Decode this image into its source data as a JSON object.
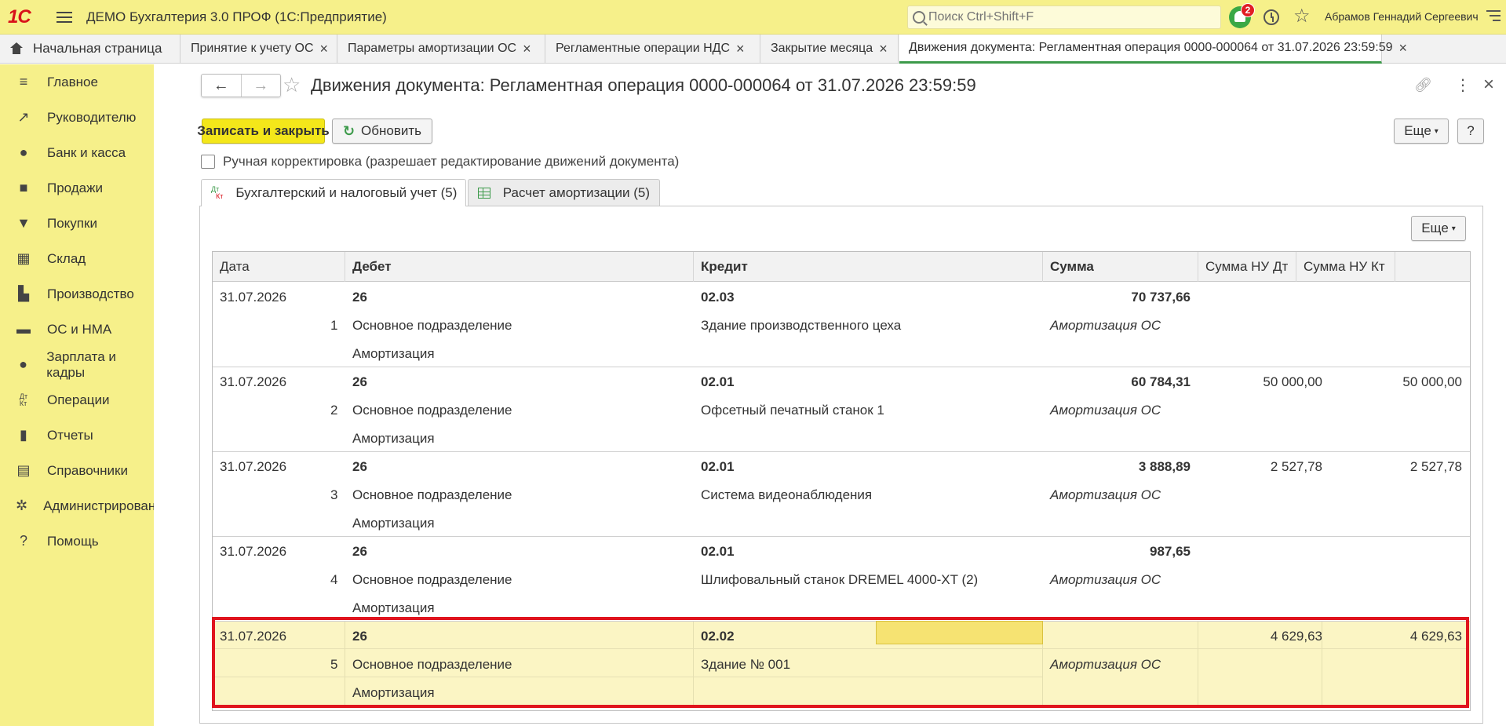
{
  "topbar": {
    "logo": "1С",
    "app_title": "ДЕМО Бухгалтерия 3.0 ПРОФ  (1С:Предприятие)",
    "search_placeholder": "Поиск Ctrl+Shift+F",
    "notifications_count": "2",
    "user_name": "Абрамов Геннадий Сергеевич"
  },
  "tabs": [
    {
      "label": "Начальная страница"
    },
    {
      "label": "Принятие к учету ОС"
    },
    {
      "label": "Параметры амортизации ОС"
    },
    {
      "label": "Регламентные операции НДС"
    },
    {
      "label": "Закрытие месяца"
    },
    {
      "label": "Движения документа: Регламентная операция 0000-000064 от 31.07.2026 23:59:59"
    }
  ],
  "sidebar": {
    "items": [
      {
        "label": "Главное",
        "icon": "menu-icon"
      },
      {
        "label": "Руководителю",
        "icon": "trend-icon"
      },
      {
        "label": "Банк и касса",
        "icon": "ruble-coin-icon"
      },
      {
        "label": "Продажи",
        "icon": "bag-icon"
      },
      {
        "label": "Покупки",
        "icon": "cart-icon"
      },
      {
        "label": "Склад",
        "icon": "warehouse-icon"
      },
      {
        "label": "Производство",
        "icon": "factory-icon"
      },
      {
        "label": "ОС и НМА",
        "icon": "truck-icon"
      },
      {
        "label": "Зарплата и кадры",
        "icon": "person-icon"
      },
      {
        "label": "Операции",
        "icon": "dt-kt-icon"
      },
      {
        "label": "Отчеты",
        "icon": "bar-chart-icon"
      },
      {
        "label": "Справочники",
        "icon": "books-icon"
      },
      {
        "label": "Администрирование",
        "icon": "gear-icon"
      },
      {
        "label": "Помощь",
        "icon": "question-icon"
      }
    ]
  },
  "document": {
    "title": "Движения документа: Регламентная операция 0000-000064 от 31.07.2026 23:59:59",
    "save_close_label": "Записать и закрыть",
    "refresh_label": "Обновить",
    "more_label": "Еще",
    "help_label": "?",
    "manual_correction_label": "Ручная корректировка (разрешает редактирование движений документа)",
    "form_tabs": [
      {
        "label": "Бухгалтерский и налоговый учет (5)"
      },
      {
        "label": "Расчет амортизации (5)"
      }
    ],
    "table_more_label": "Еще"
  },
  "table": {
    "columns": [
      "Дата",
      "Дебет",
      "Кредит",
      "Сумма",
      "Сумма НУ Дт",
      "Сумма НУ Кт"
    ],
    "rows": [
      {
        "date": "31.07.2026",
        "num": "1",
        "debit_account": "26",
        "debit_sub1": "Основное подразделение",
        "debit_sub2": "Амортизация",
        "credit_account": "02.03",
        "credit_sub1": "Здание производственного цеха",
        "sum": "70 737,66",
        "content": "Амортизация ОС",
        "nu_dt": "",
        "nu_kt": ""
      },
      {
        "date": "31.07.2026",
        "num": "2",
        "debit_account": "26",
        "debit_sub1": "Основное подразделение",
        "debit_sub2": "Амортизация",
        "credit_account": "02.01",
        "credit_sub1": "Офсетный печатный станок 1",
        "sum": "60 784,31",
        "content": "Амортизация ОС",
        "nu_dt": "50 000,00",
        "nu_kt": "50 000,00"
      },
      {
        "date": "31.07.2026",
        "num": "3",
        "debit_account": "26",
        "debit_sub1": "Основное подразделение",
        "debit_sub2": "Амортизация",
        "credit_account": "02.01",
        "credit_sub1": "Система видеонаблюдения",
        "sum": "3 888,89",
        "content": "Амортизация ОС",
        "nu_dt": "2 527,78",
        "nu_kt": "2 527,78"
      },
      {
        "date": "31.07.2026",
        "num": "4",
        "debit_account": "26",
        "debit_sub1": "Основное подразделение",
        "debit_sub2": "Амортизация",
        "credit_account": "02.01",
        "credit_sub1": "Шлифовальный станок DREMEL 4000-XT (2)",
        "sum": "987,65",
        "content": "Амортизация ОС",
        "nu_dt": "",
        "nu_kt": ""
      },
      {
        "date": "31.07.2026",
        "num": "5",
        "debit_account": "26",
        "debit_sub1": "Основное подразделение",
        "debit_sub2": "Амортизация",
        "credit_account": "02.02",
        "credit_sub1": "Здание № 001",
        "sum": "",
        "content": "Амортизация ОС",
        "nu_dt": "4 629,63",
        "nu_kt": "4 629,63"
      }
    ]
  },
  "colors": {
    "accent_yellow": "#f6f08a",
    "primary_button": "#f4e71a",
    "selection_frame": "#e0141e",
    "active_tab_underline": "#3c9a4a"
  }
}
